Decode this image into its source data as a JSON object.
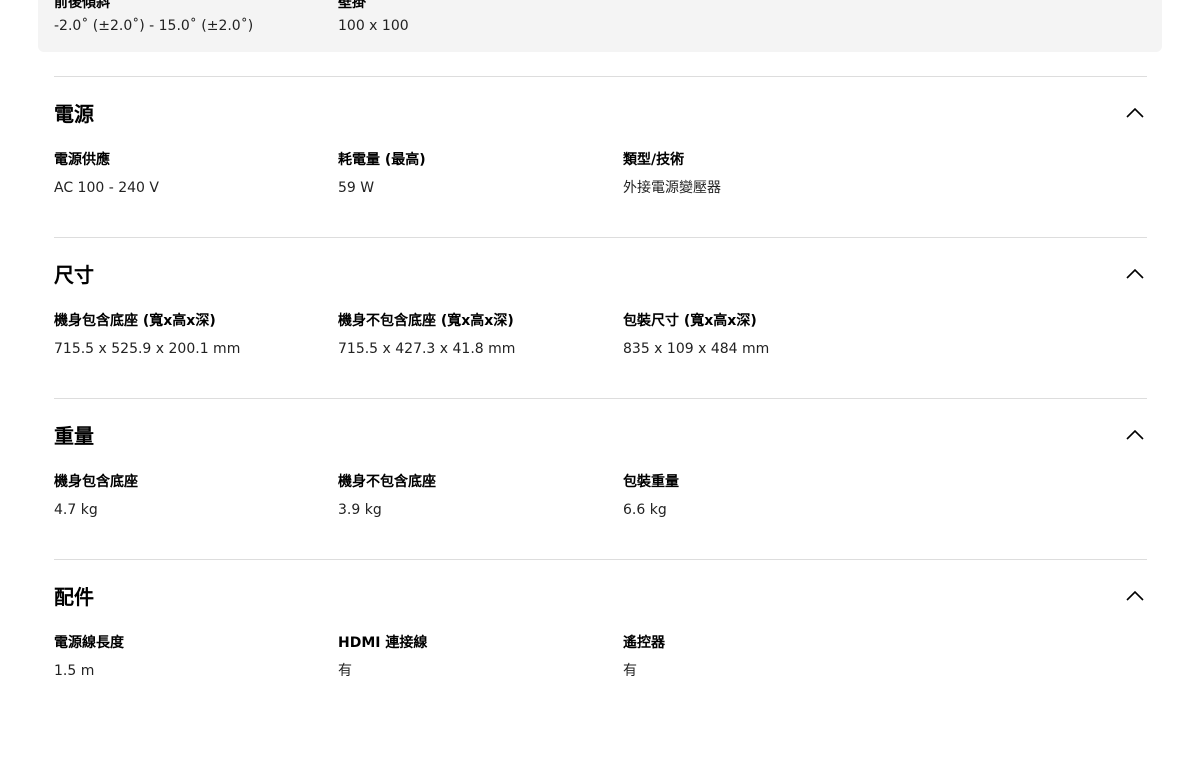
{
  "top_specs": [
    {
      "label": "前後傾斜",
      "value": "-2.0˚ (±2.0˚) - 15.0˚ (±2.0˚)"
    },
    {
      "label": "壁掛",
      "value": "100 x 100"
    }
  ],
  "sections": [
    {
      "title": "電源",
      "specs": [
        {
          "label": "電源供應",
          "value": "AC 100 - 240 V"
        },
        {
          "label": "耗電量 (最高)",
          "value": "59 W"
        },
        {
          "label": "類型/技術",
          "value": "外接電源變壓器"
        }
      ]
    },
    {
      "title": "尺寸",
      "specs": [
        {
          "label": "機身包含底座 (寬x高x深)",
          "value": "715.5 x 525.9 x 200.1 mm"
        },
        {
          "label": "機身不包含底座 (寬x高x深)",
          "value": "715.5 x 427.3 x 41.8 mm"
        },
        {
          "label": "包裝尺寸 (寬x高x深)",
          "value": "835 x 109 x 484 mm"
        }
      ]
    },
    {
      "title": "重量",
      "specs": [
        {
          "label": "機身包含底座",
          "value": "4.7 kg"
        },
        {
          "label": "機身不包含底座",
          "value": "3.9 kg"
        },
        {
          "label": "包裝重量",
          "value": "6.6 kg"
        }
      ]
    },
    {
      "title": "配件",
      "specs": [
        {
          "label": "電源線長度",
          "value": "1.5 m"
        },
        {
          "label": "HDMI 連接線",
          "value": "有"
        },
        {
          "label": "遙控器",
          "value": "有"
        }
      ]
    }
  ],
  "icons": {
    "collapse": "chevron-up-icon"
  }
}
